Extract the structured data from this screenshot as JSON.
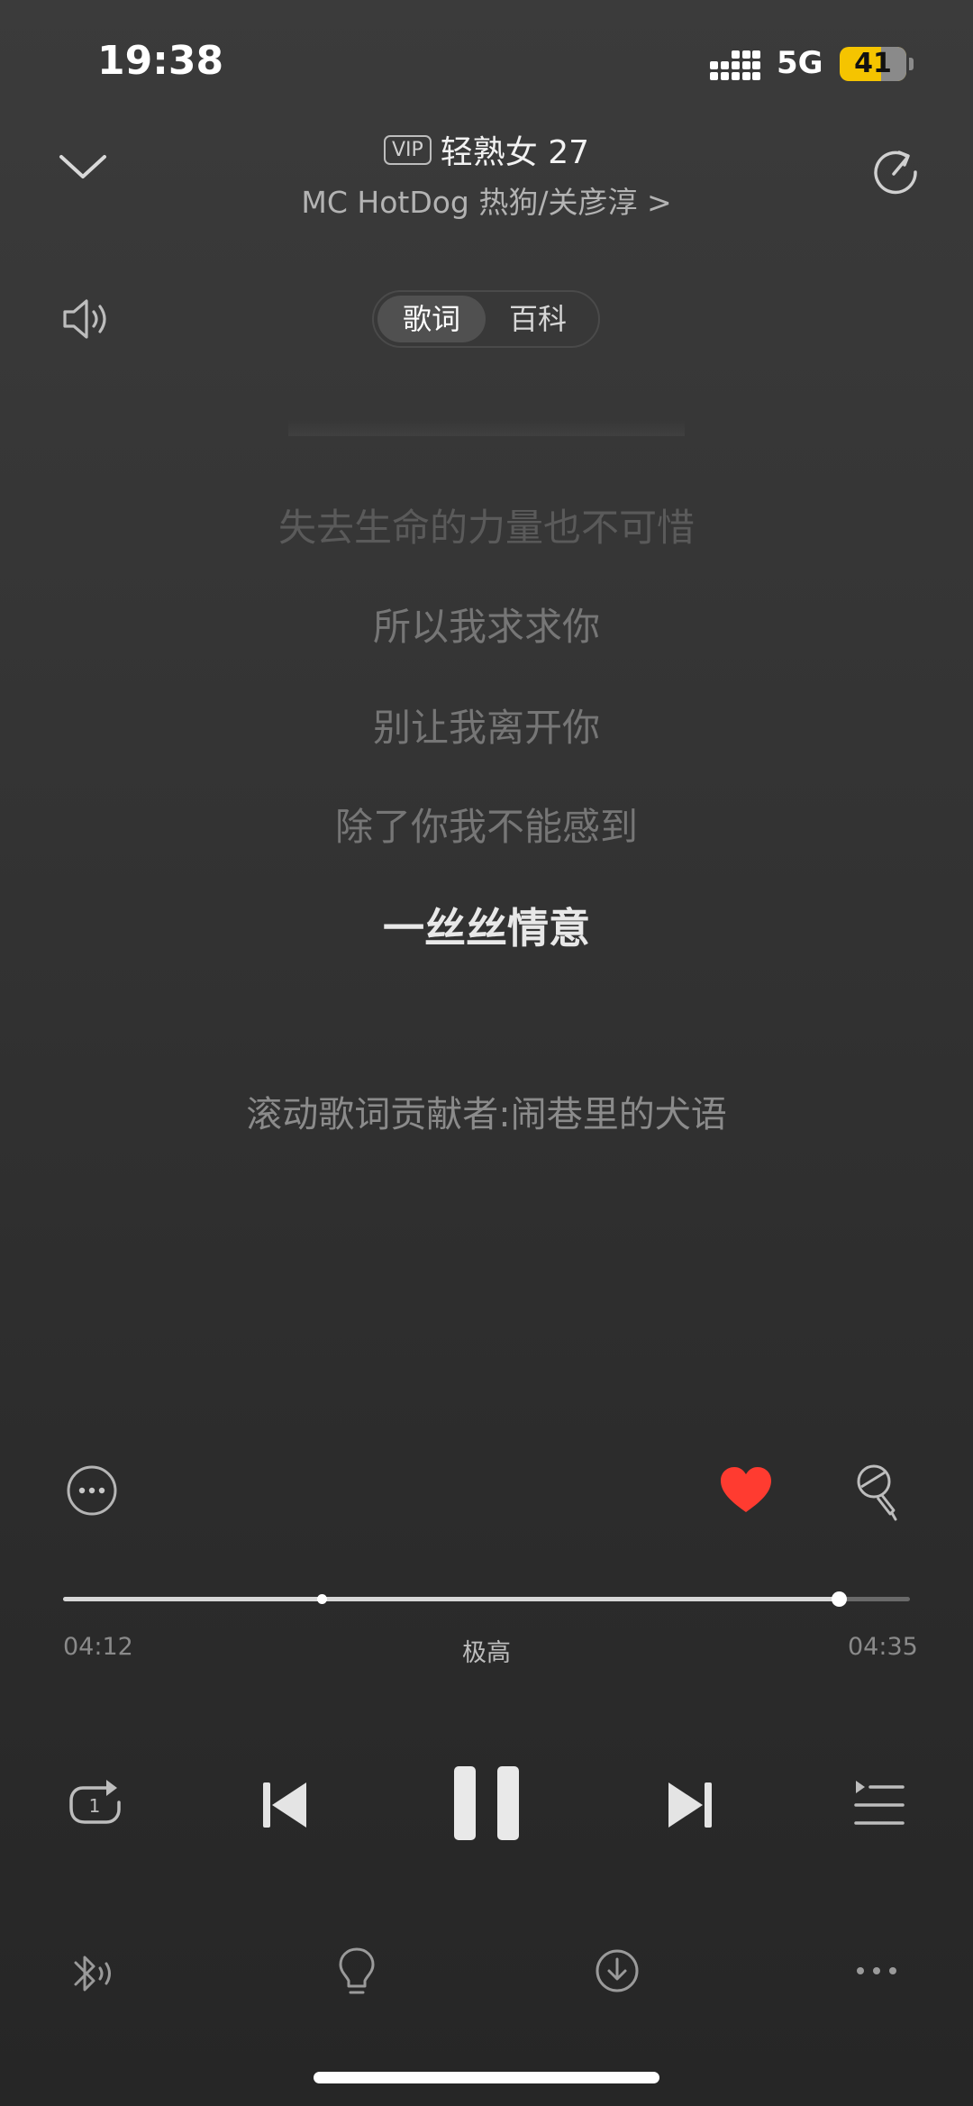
{
  "status_bar": {
    "time": "19:38",
    "network": "5G",
    "battery": "41"
  },
  "header": {
    "badge": "VIP",
    "song_title": "轻熟女 27",
    "artist": "MC HotDog 热狗/关彦淳 >"
  },
  "tabs": [
    {
      "label": "歌词",
      "active": true
    },
    {
      "label": "百科",
      "active": false
    }
  ],
  "lyrics": [
    "失去生命的力量也不可惜",
    "所以我求求你",
    "别让我离开你",
    "除了你我不能感到",
    "一丝丝情意"
  ],
  "lyrics_credit": "滚动歌词贡献者:闹巷里的犬语",
  "playback": {
    "elapsed": "04:12",
    "total": "04:35",
    "quality": "极高",
    "progress_fraction": 0.916,
    "marker_fraction": 0.305
  },
  "icons": {
    "collapse": "chevron-down-icon",
    "share": "share-icon",
    "volume": "speaker-icon",
    "more_circle": "more-circle-icon",
    "like": "heart-icon",
    "sing": "microphone-icon",
    "repeat_one": "repeat-one-icon",
    "prev": "previous-icon",
    "pause": "pause-icon",
    "next": "next-icon",
    "playlist": "playlist-icon",
    "bluetooth": "bluetooth-audio-icon",
    "lightbulb": "lightbulb-icon",
    "download": "download-icon",
    "more": "more-icon"
  },
  "colors": {
    "like": "#ff3b30",
    "background": "#333333"
  }
}
